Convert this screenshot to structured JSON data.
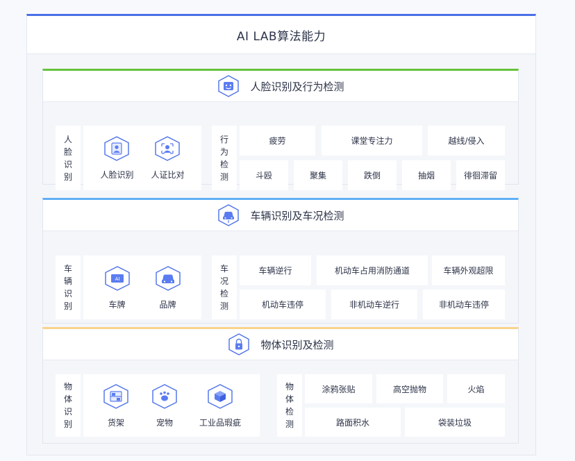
{
  "title": "AI LAB算法能力",
  "colors": {
    "accent": "#4a6fe8",
    "green": "#67c23a",
    "blue": "#5fb0f5",
    "orange": "#f9d38a"
  },
  "sections": [
    {
      "title": "人脸识别及行为检测",
      "icon": "face-icon",
      "recog_label": "人脸识别",
      "recog_items": [
        {
          "label": "人脸识别",
          "icon": "face-portrait-icon"
        },
        {
          "label": "人证比对",
          "icon": "id-card-icon"
        }
      ],
      "detect_label": "行为检测",
      "detect_items": [
        "疲劳",
        "课堂专注力",
        "越线/侵入",
        "斗殴",
        "聚集",
        "跌倒",
        "抽烟",
        "徘徊滞留"
      ]
    },
    {
      "title": "车辆识别及车况检测",
      "icon": "car-icon",
      "recog_label": "车辆识别",
      "recog_items": [
        {
          "label": "车牌",
          "icon": "license-plate-icon",
          "badge": "AI"
        },
        {
          "label": "品牌",
          "icon": "car-brand-icon"
        }
      ],
      "detect_label": "车况检测",
      "detect_items": [
        "车辆逆行",
        "机动车占用消防通道",
        "车辆外观超限",
        "机动车违停",
        "非机动车逆行",
        "非机动车违停"
      ]
    },
    {
      "title": "物体识别及检测",
      "icon": "lock-object-icon",
      "recog_label": "物体识别",
      "recog_items": [
        {
          "label": "货架",
          "icon": "shelf-icon"
        },
        {
          "label": "宠物",
          "icon": "paw-icon"
        },
        {
          "label": "工业品瑕疵",
          "icon": "box-icon"
        }
      ],
      "detect_label": "物体检测",
      "detect_items": [
        "涂鸦张贴",
        "高空抛物",
        "火焰",
        "路面积水",
        "袋装垃圾"
      ]
    }
  ]
}
